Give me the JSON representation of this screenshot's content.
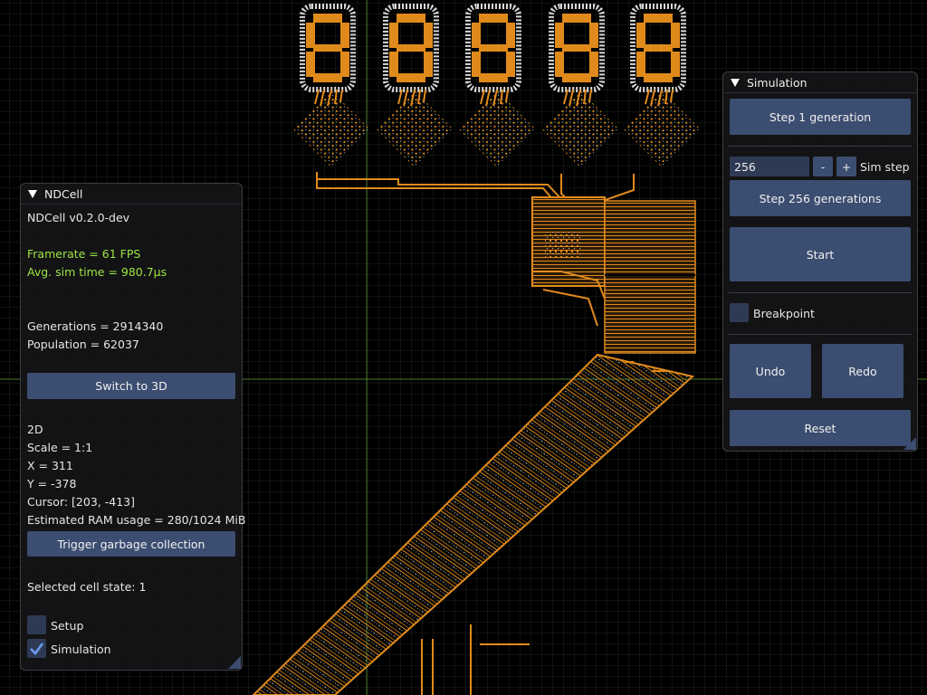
{
  "colors": {
    "background": "#000000",
    "grid": "#1c2a1c",
    "crosshair": "#5a8a3a",
    "circuit_orange": "#e08a1c",
    "circuit_white": "#d8d8d8",
    "button": "#3b4d70",
    "green_text": "#9de643"
  },
  "ndcell": {
    "title": "NDCell",
    "version": "NDCell v0.2.0-dev",
    "framerate": "Framerate = 61 FPS",
    "sim_time": "Avg. sim time = 980.7μs",
    "generations": "Generations = 2914340",
    "population": "Population = 62037",
    "switch_button": "Switch to 3D",
    "mode": "2D",
    "scale": "Scale = 1:1",
    "x": "X = 311",
    "y": "Y = -378",
    "cursor": "Cursor: [203, -413]",
    "ram": "Estimated RAM usage = 280/1024 MiB",
    "gc_button": "Trigger garbage collection",
    "selected_state": "Selected cell state: 1",
    "setup_label": "Setup",
    "setup_checked": false,
    "simulation_label": "Simulation",
    "simulation_checked": true
  },
  "simulation": {
    "title": "Simulation",
    "step1_button": "Step 1 generation",
    "step_value": "256",
    "minus_label": "-",
    "plus_label": "+",
    "sim_step_label": "Sim step",
    "stepN_button": "Step 256 generations",
    "start_button": "Start",
    "breakpoint_label": "Breakpoint",
    "breakpoint_checked": false,
    "undo_button": "Undo",
    "redo_button": "Redo",
    "reset_button": "Reset"
  }
}
